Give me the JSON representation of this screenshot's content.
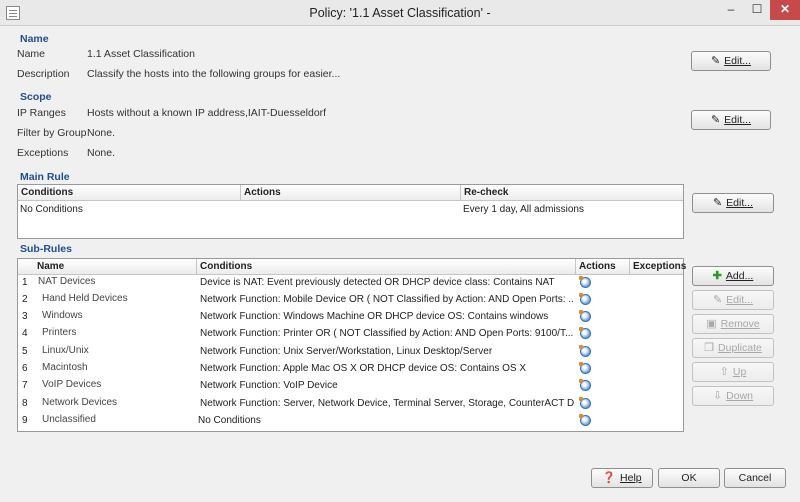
{
  "window": {
    "title": "Policy: '1.1 Asset Classification' -",
    "minimize": "–",
    "maximize": "☐",
    "close": "✕"
  },
  "name_section": {
    "title": "Name",
    "name_label": "Name",
    "name_value": "1.1 Asset Classification",
    "description_label": "Description",
    "description_value": "Classify the hosts into the following groups for easier..."
  },
  "scope_section": {
    "title": "Scope",
    "ip_ranges_label": "IP Ranges",
    "ip_ranges_value": "Hosts without a known IP address,IAIT-Duesseldorf",
    "filter_label": "Filter by Group",
    "filter_value": "None.",
    "exceptions_label": "Exceptions",
    "exceptions_value": "None."
  },
  "main_rule": {
    "title": "Main Rule",
    "columns": [
      "Conditions",
      "Actions",
      "Re-check"
    ],
    "row": {
      "conditions": "No Conditions",
      "actions": "",
      "recheck": "Every 1 day, All admissions"
    }
  },
  "sub_rules": {
    "title": "Sub-Rules",
    "columns": [
      "Name",
      "Conditions",
      "Actions",
      "Exceptions"
    ],
    "rows": [
      {
        "num": "1",
        "name": "NAT Devices",
        "conditions": "Device is NAT: Event previously detected  OR  DHCP device class: Contains NAT"
      },
      {
        "num": "2",
        "name": "Hand Held Devices",
        "conditions": "Network Function: Mobile Device  OR  (  NOT  Classified by Action:   AND  Open Ports: ..."
      },
      {
        "num": "3",
        "name": "Windows",
        "conditions": "Network Function: Windows Machine  OR  DHCP device OS: Contains windows"
      },
      {
        "num": "4",
        "name": "Printers",
        "conditions": "Network Function: Printer  OR  (  NOT  Classified by Action:   AND  Open Ports: 9100/T..."
      },
      {
        "num": "5",
        "name": "Linux/Unix",
        "conditions": "Network Function: Unix Server/Workstation, Linux Desktop/Server"
      },
      {
        "num": "6",
        "name": "Macintosh",
        "conditions": "Network Function: Apple Mac OS X  OR  DHCP device OS: Contains OS X"
      },
      {
        "num": "7",
        "name": "VoIP Devices",
        "conditions": "Network Function: VoIP Device"
      },
      {
        "num": "8",
        "name": "Network Devices",
        "conditions": "Network Function: Server, Network Device, Terminal Server, Storage, CounterACT Devi..."
      },
      {
        "num": "9",
        "name": "Unclassified",
        "conditions": "No Conditions"
      }
    ]
  },
  "buttons": {
    "edit": "Edit...",
    "add": "Add...",
    "sub_edit": "Edit...",
    "remove": "Remove",
    "duplicate": "Duplicate",
    "up": "Up",
    "down": "Down",
    "help": "Help",
    "ok": "OK",
    "cancel": "Cancel"
  }
}
